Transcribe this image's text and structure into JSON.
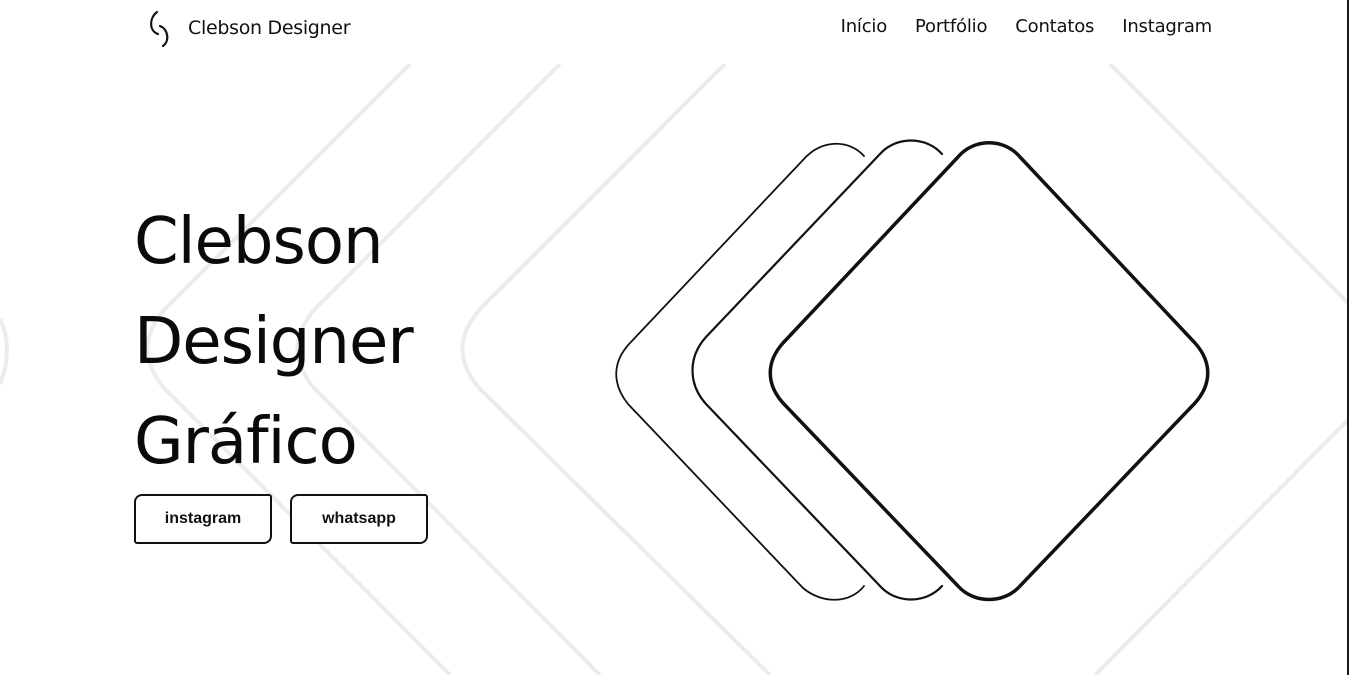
{
  "brand": {
    "name": "Clebson Designer",
    "logo_icon": "crescent-logo-icon"
  },
  "nav": {
    "items": [
      "Início",
      "Portfólio",
      "Contatos",
      "Instagram"
    ]
  },
  "hero": {
    "title_lines": [
      "Clebson",
      "Designer",
      "Gráfico"
    ],
    "buttons": {
      "instagram": "instagram",
      "whatsapp": "whatsapp"
    },
    "art_icon": "layered-rounded-diamonds-icon"
  },
  "colors": {
    "background": "#ffffff",
    "text": "#111111",
    "background_lines": "#ececec"
  }
}
